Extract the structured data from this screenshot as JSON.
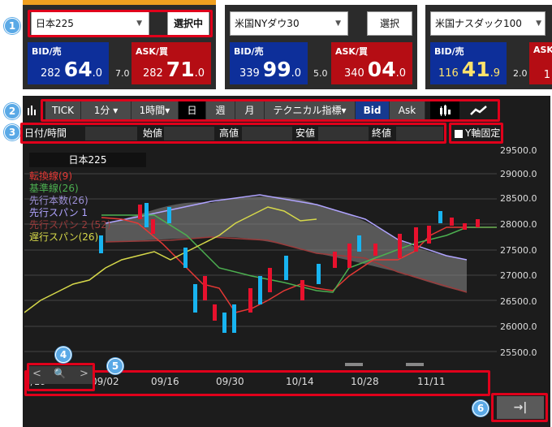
{
  "markers": {
    "m1": "1",
    "m2": "2",
    "m3": "3",
    "m4": "4",
    "m5": "5",
    "m6": "6"
  },
  "panels": [
    {
      "symbol": "日本225",
      "select_label": "選択中",
      "bid_label": "BID/売",
      "bid_small": "282",
      "bid_big": "64",
      "bid_dec": ".0",
      "spread": "7.0",
      "ask_label": "ASK/買",
      "ask_small": "282",
      "ask_big": "71",
      "ask_dec": ".0"
    },
    {
      "symbol": "米国NYダウ30",
      "select_label": "選択",
      "bid_label": "BID/売",
      "bid_small": "339",
      "bid_big": "99",
      "bid_dec": ".0",
      "spread": "5.0",
      "ask_label": "ASK/買",
      "ask_small": "340",
      "ask_big": "04",
      "ask_dec": ".0"
    },
    {
      "symbol": "米国ナスダック100",
      "bid_label": "BID/売",
      "bid_small": "116",
      "bid_big": "41",
      "bid_dec": ".9",
      "spread": "2.0",
      "ask_label": "ASK",
      "ask_small": "1"
    }
  ],
  "toolbar": {
    "tick": "TICK",
    "interval_min": "1分",
    "interval_hour": "1時間",
    "day": "日",
    "week": "週",
    "month": "月",
    "technical": "テクニカル指標",
    "bid": "Bid",
    "ask": "Ask"
  },
  "header": {
    "datetime": "日付/時間",
    "open": "始値",
    "high": "高値",
    "low": "安値",
    "close": "終値",
    "y_fixed": "Y軸固定"
  },
  "chart_title": "日本225",
  "legend": [
    {
      "label": "転換線(9)",
      "color": "#e53935"
    },
    {
      "label": "基準線(26)",
      "color": "#4caf50"
    },
    {
      "label": "先行本数(26)",
      "color": "#9c8fd6"
    },
    {
      "label": "先行スパン 1",
      "color": "#b0a4ff"
    },
    {
      "label": "先行スパン 2 (52)",
      "color": "#9b3b3b"
    },
    {
      "label": "遅行スパン(26)",
      "color": "#d6d84a"
    }
  ],
  "y_axis": [
    "29500.0",
    "29000.0",
    "28500.0",
    "28000.0",
    "27500.0",
    "27000.0",
    "26500.0",
    "26000.0",
    "25500.0"
  ],
  "x_axis": [
    "8/19",
    "09/02",
    "09/16",
    "09/30",
    "10/14",
    "10/28",
    "11/11"
  ],
  "nav": {
    "prev": "<",
    "zoom": "🔍",
    "next": ">"
  },
  "latest_icon": "→|",
  "colors": {
    "accent": "#e0001b",
    "bid": "#0d2f9a",
    "ask": "#b50d14",
    "up": "#e8112d",
    "down": "#18b4f0",
    "marker": "#5aa9e6"
  },
  "chart_data": {
    "type": "candlestick",
    "title": "日本225",
    "x": [
      "8/19",
      "09/02",
      "09/16",
      "09/30",
      "10/14",
      "10/28",
      "11/11"
    ],
    "ylim": [
      25500,
      29500
    ],
    "series": [
      {
        "name": "転換線(9)"
      },
      {
        "name": "基準線(26)"
      },
      {
        "name": "先行本数(26)"
      },
      {
        "name": "先行スパン 1"
      },
      {
        "name": "先行スパン 2 (52)"
      },
      {
        "name": "遅行スパン(26)"
      }
    ]
  }
}
